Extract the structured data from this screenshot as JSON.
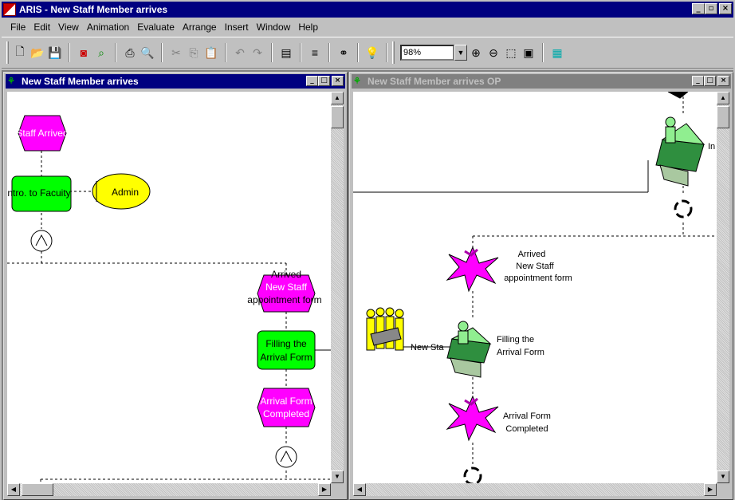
{
  "window": {
    "title": "ARIS - New Staff Member arrives"
  },
  "menu": [
    "File",
    "Edit",
    "View",
    "Animation",
    "Evaluate",
    "Arrange",
    "Insert",
    "Window",
    "Help"
  ],
  "toolbar": {
    "zoom_value": "98%"
  },
  "left_window": {
    "title": "New Staff Member arrives",
    "shapes": {
      "staff_arrived": "Staff Arrived",
      "intro_to_faculty": "ntro. to Facuity",
      "admin": "Admin",
      "arrived_line1": "Arrived",
      "arrived_line2": "New Staff",
      "arrived_line3": "appointment form",
      "filling_line1": "Filling the",
      "filling_line2": "Arrival Form",
      "completed_line1": "Arrival Form",
      "completed_line2": "Completed"
    }
  },
  "right_window": {
    "title": "New Staff Member arrives OP",
    "labels": {
      "top_cut": "In",
      "arrived_line1": "Arrived",
      "arrived_line2": "New Staff",
      "arrived_line3": "appointment form",
      "new_staff": "New Sta",
      "filling_line1": "Filling the",
      "filling_line2": "Arrival Form",
      "completed_line1": "Arrival Form",
      "completed_line2": "Completed"
    }
  },
  "colors": {
    "event": "#ff00ff",
    "function": "#00ff00",
    "org_unit": "#ffff00",
    "title_active": "#000080",
    "title_inactive": "#808080"
  }
}
